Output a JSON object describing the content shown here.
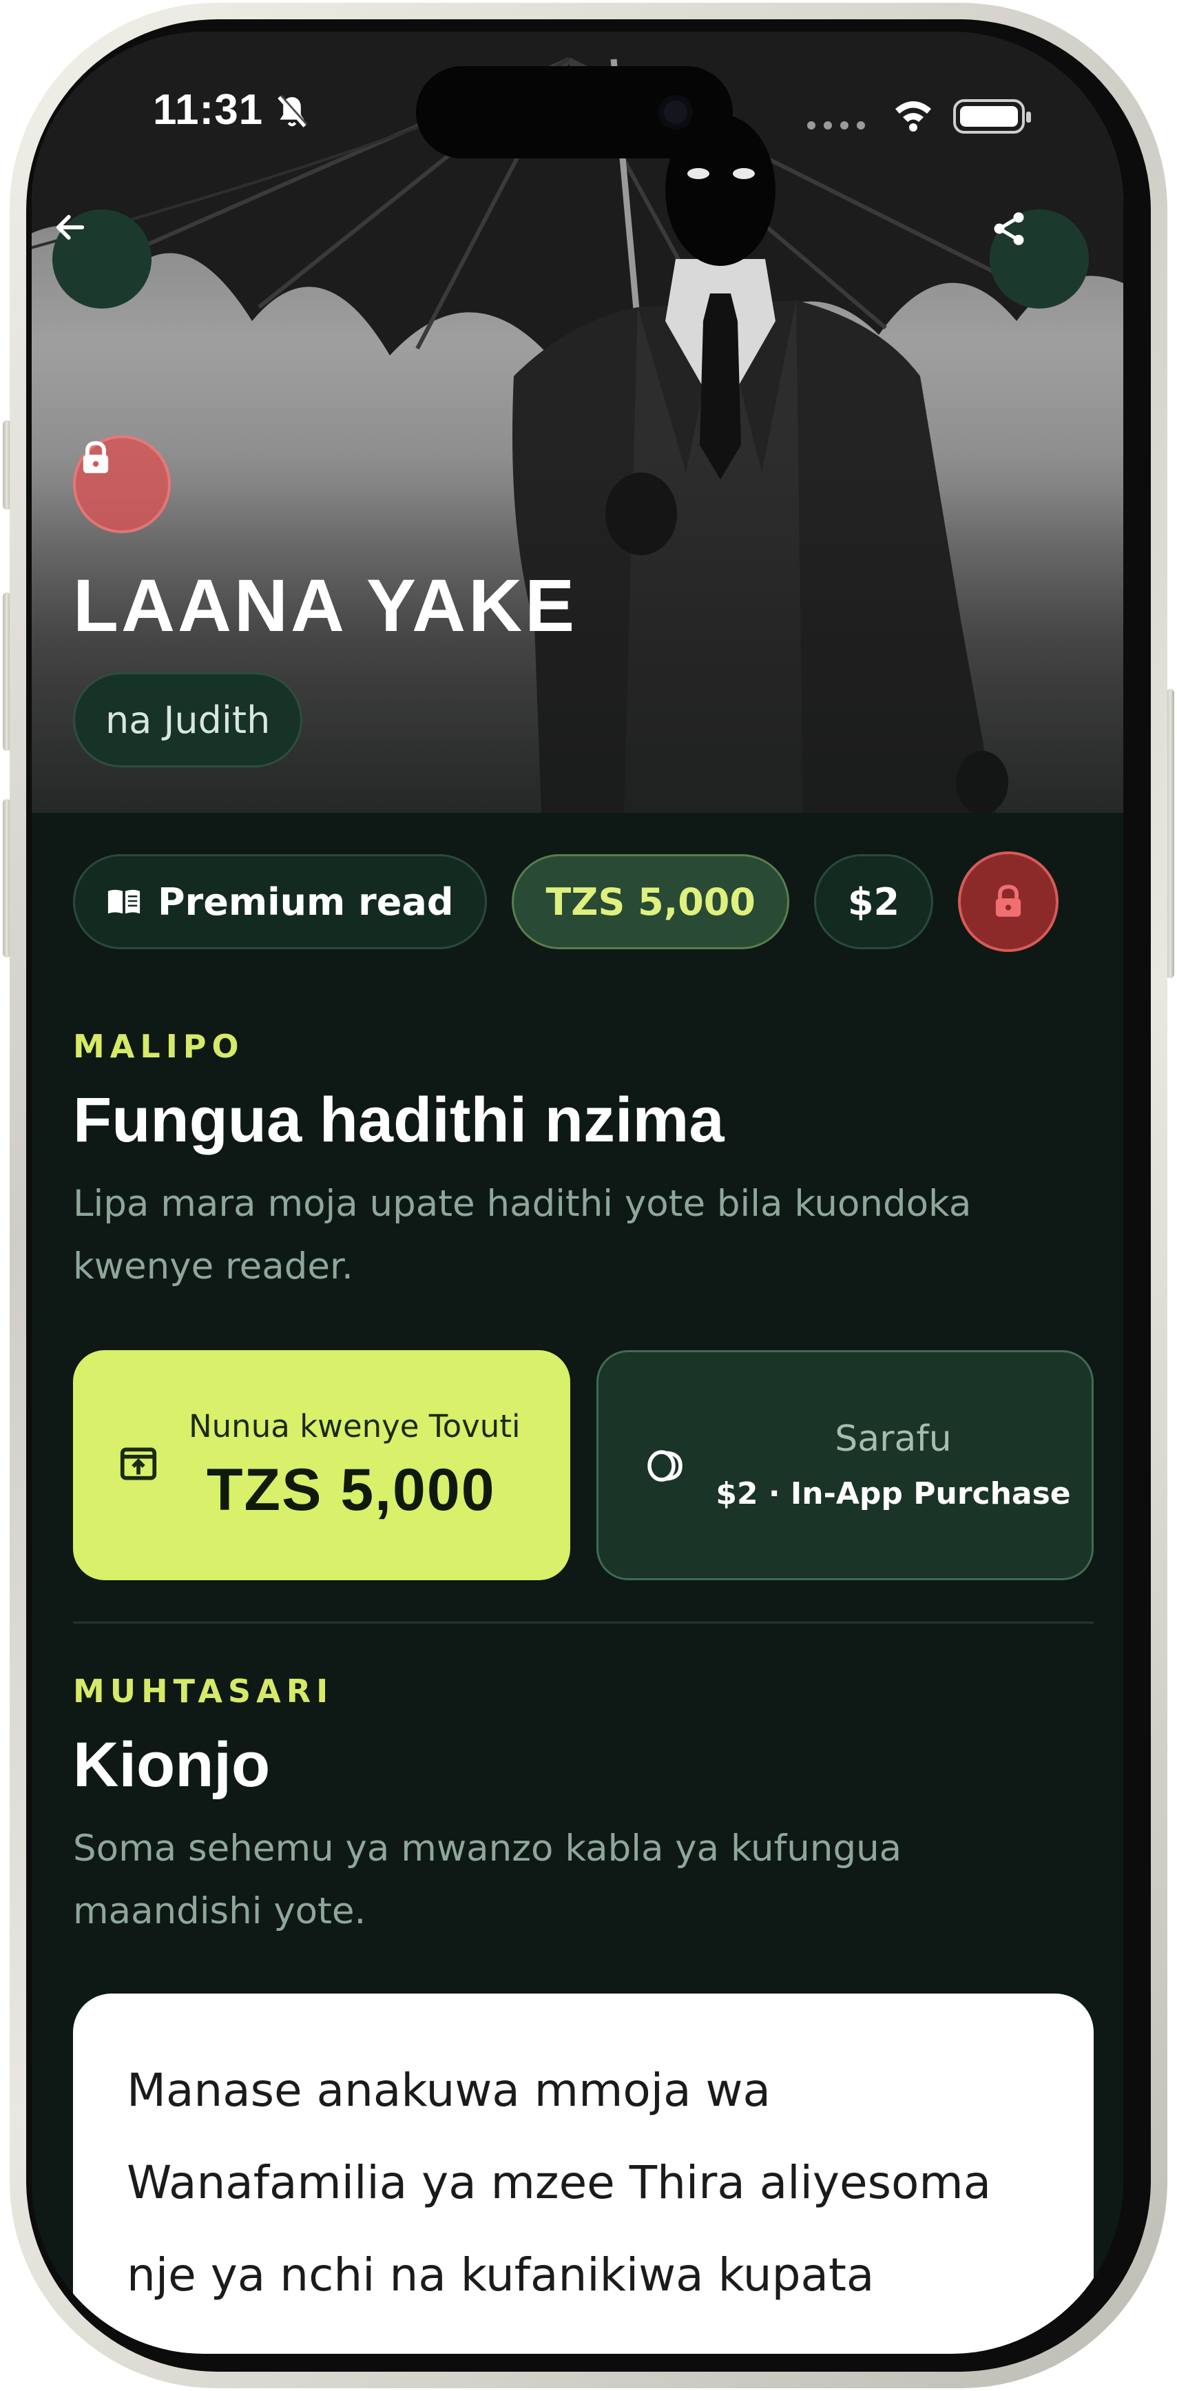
{
  "status_bar": {
    "time": "11:31"
  },
  "hero": {
    "title": "LAANA YAKE",
    "author": "na Judith"
  },
  "chips": {
    "premium_label": "Premium read",
    "price_tzs": "TZS 5,000",
    "price_usd": "$2"
  },
  "payment": {
    "eyebrow": "MALIPO",
    "heading": "Fungua hadithi nzima",
    "description": "Lipa mara moja upate hadithi yote bila kuondoka kwenye reader.",
    "web_buy": {
      "label": "Nunua kwenye Tovuti",
      "amount": "TZS 5,000"
    },
    "coins": {
      "label": "Sarafu",
      "sub": "$2 · In-App Purchase"
    }
  },
  "summary": {
    "eyebrow": "MUHTASARI",
    "heading": "Kionjo",
    "description": "Soma sehemu ya mwanzo kabla ya kufungua maandishi yote.",
    "preview_text": "Manase anakuwa mmoja wa Wanafamilia ya mzee Thira aliyesoma nje ya nchi na kufanikiwa kupata"
  },
  "colors": {
    "background": "#0e1915",
    "accent": "#d8f06a",
    "lock_red": "#d65656",
    "button_green": "#1b3a2d"
  },
  "icons": {
    "back": "arrow-left-icon",
    "share": "share-icon",
    "lock": "lock-icon",
    "book": "book-open-icon",
    "web_buy": "external-purchase-icon",
    "coins": "coins-icon",
    "bell_muted": "bell-slash-icon",
    "wifi": "wifi-icon",
    "battery": "battery-icon"
  }
}
